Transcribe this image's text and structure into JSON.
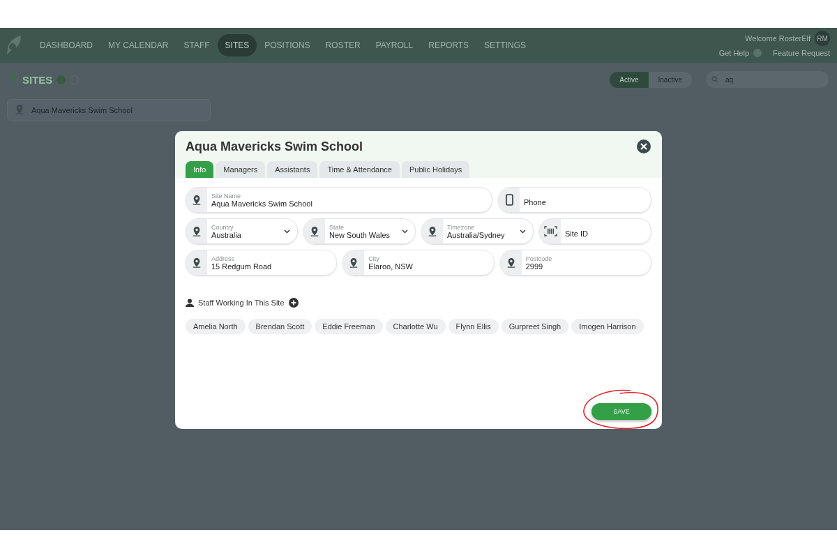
{
  "nav": {
    "items": [
      {
        "label": "DASHBOARD",
        "selected": false
      },
      {
        "label": "MY CALENDAR",
        "selected": false
      },
      {
        "label": "STAFF",
        "selected": false
      },
      {
        "label": "SITES",
        "selected": true
      },
      {
        "label": "POSITIONS",
        "selected": false
      },
      {
        "label": "ROSTER",
        "selected": false
      },
      {
        "label": "PAYROLL",
        "selected": false
      },
      {
        "label": "REPORTS",
        "selected": false
      },
      {
        "label": "SETTINGS",
        "selected": false
      }
    ],
    "welcome": "Welcome RosterElf",
    "avatar": "RM",
    "help": "Get Help",
    "feature": "Feature Request"
  },
  "page": {
    "title": "SITES",
    "filters": [
      {
        "label": "Active",
        "selected": true
      },
      {
        "label": "Inactive",
        "selected": false
      }
    ],
    "search": {
      "value": "aq"
    },
    "sites": [
      "Aqua Mavericks Swim School"
    ]
  },
  "dialog": {
    "title": "Aqua Mavericks Swim School",
    "tabs": [
      {
        "label": "Info",
        "selected": true
      },
      {
        "label": "Managers",
        "selected": false
      },
      {
        "label": "Assistants",
        "selected": false
      },
      {
        "label": "Time & Attendance",
        "selected": false
      },
      {
        "label": "Public Holidays",
        "selected": false
      }
    ],
    "rows": [
      [
        {
          "kind": "text",
          "label": "Site Name",
          "value": "Aqua Mavericks Swim School"
        },
        {
          "kind": "phone",
          "label": "Phone"
        }
      ],
      [
        {
          "kind": "select",
          "label": "Country",
          "value": "Australia"
        },
        {
          "kind": "select",
          "label": "State",
          "value": "New South Wales"
        },
        {
          "kind": "select",
          "label": "Timezone",
          "value": "Australia/Sydney"
        },
        {
          "kind": "code",
          "label": "Site ID"
        }
      ],
      [
        {
          "kind": "text",
          "label": "Address",
          "value": "15 Redgum Road"
        },
        {
          "kind": "text",
          "label": "City",
          "value": "Elaroo, NSW"
        },
        {
          "kind": "text",
          "label": "Postcode",
          "value": "2999"
        }
      ]
    ],
    "staff_heading": "Staff Working In This Site",
    "staff": [
      "Amelia North",
      "Brendan Scott",
      "Eddie Freeman",
      "Charlotte Wu",
      "Flynn Ellis",
      "Gurpreet Singh",
      "Imogen Harrison"
    ],
    "save": "SAVE"
  }
}
